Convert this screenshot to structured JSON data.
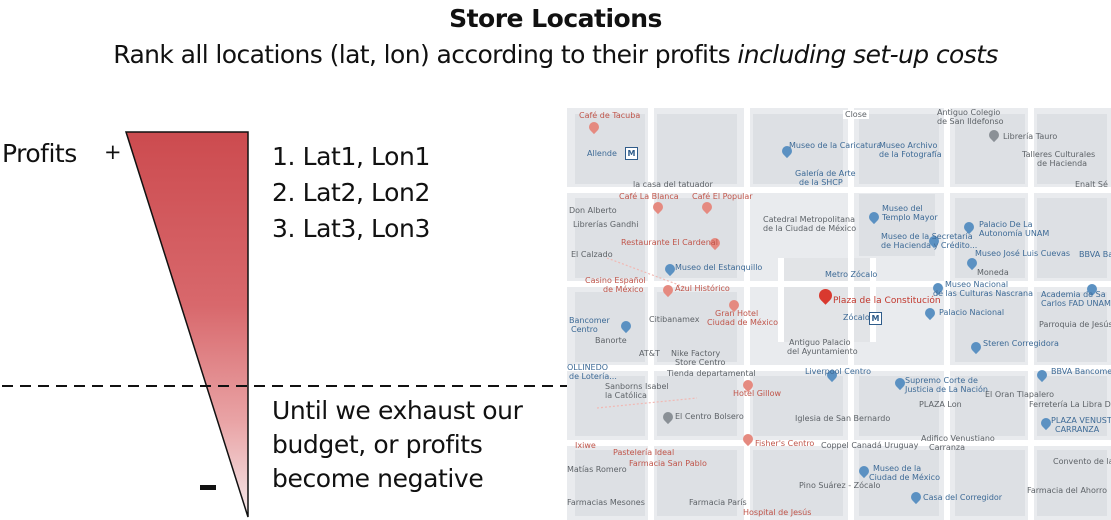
{
  "header": {
    "title": "Store Locations",
    "subtitle_main": "Rank all locations (lat, lon) according to their profits ",
    "subtitle_emphasis": "including set-up costs"
  },
  "funnel": {
    "axis_label": "Profits",
    "top_sign": "+",
    "bottom_sign": "–",
    "gradient_top_color": "#cc4b4f",
    "gradient_bottom_color": "#f5e9ea"
  },
  "ranking": {
    "items": [
      "1. Lat1, Lon1",
      "2. Lat2, Lon2",
      "3. Lat3, Lon3"
    ]
  },
  "cutoff": {
    "lines": [
      "Until we exhaust our",
      "budget, or profits",
      "become negative"
    ]
  },
  "map": {
    "highlight_place": "Plaza de la Constitución",
    "pois": [
      {
        "text": "Café de Tacuba",
        "tone": "red",
        "pin": false
      },
      {
        "text": "Antiguo Colegio",
        "tone": "gray",
        "pin": false
      },
      {
        "text": "de San Ildefonso",
        "tone": "gray",
        "pin": false
      },
      {
        "text": "Close",
        "tone": "gray",
        "pin": false
      },
      {
        "text": "Librería Tauro",
        "tone": "gray",
        "pin": false
      },
      {
        "text": "Museo de la Caricatura",
        "tone": "blue",
        "pin": false
      },
      {
        "text": "Museo Archivo",
        "tone": "blue",
        "pin": false
      },
      {
        "text": "de la Fotografía",
        "tone": "blue",
        "pin": false
      },
      {
        "text": "Allende",
        "tone": "blue",
        "pin": false
      },
      {
        "text": "Talleres Culturales",
        "tone": "gray",
        "pin": false
      },
      {
        "text": "de Hacienda",
        "tone": "gray",
        "pin": false
      },
      {
        "text": "Enalt Sé",
        "tone": "gray",
        "pin": false
      },
      {
        "text": "la casa del tatuador",
        "tone": "gray",
        "pin": false
      },
      {
        "text": "Galería de Arte",
        "tone": "blue",
        "pin": false
      },
      {
        "text": "de la SHCP",
        "tone": "blue",
        "pin": false
      },
      {
        "text": "Café La Blanca",
        "tone": "red",
        "pin": false
      },
      {
        "text": "Café El Popular",
        "tone": "red",
        "pin": false
      },
      {
        "text": "Palacio De La",
        "tone": "blue",
        "pin": false
      },
      {
        "text": "Autonomía UNAM",
        "tone": "blue",
        "pin": false
      },
      {
        "text": "Don Alberto",
        "tone": "gray",
        "pin": false
      },
      {
        "text": "Librerías Gandhi",
        "tone": "gray",
        "pin": false
      },
      {
        "text": "Museo del",
        "tone": "blue",
        "pin": false
      },
      {
        "text": "Templo Mayor",
        "tone": "blue",
        "pin": false
      },
      {
        "text": "Catedral Metropolitana",
        "tone": "gray",
        "pin": false
      },
      {
        "text": "de la Ciudad de México",
        "tone": "gray",
        "pin": false
      },
      {
        "text": "Museo de la Secretaría",
        "tone": "blue",
        "pin": false
      },
      {
        "text": "de Hacienda y Crédito...",
        "tone": "blue",
        "pin": false
      },
      {
        "text": "Museo José Luis Cuevas",
        "tone": "blue",
        "pin": false
      },
      {
        "text": "BBVA Ban",
        "tone": "blue",
        "pin": false
      },
      {
        "text": "Restaurante El Cardenal",
        "tone": "red",
        "pin": false
      },
      {
        "text": "El Calzado",
        "tone": "gray",
        "pin": false
      },
      {
        "text": "Museo del Estanquillo",
        "tone": "blue",
        "pin": false
      },
      {
        "text": "Metro Zócalo",
        "tone": "blue",
        "pin": false
      },
      {
        "text": "Moneda",
        "tone": "gray",
        "pin": false
      },
      {
        "text": "Casino Español",
        "tone": "red",
        "pin": false
      },
      {
        "text": "de México",
        "tone": "red",
        "pin": false
      },
      {
        "text": "Azul Histórico",
        "tone": "red",
        "pin": false
      },
      {
        "text": "Museo Nacional",
        "tone": "blue",
        "pin": false
      },
      {
        "text": "de las Culturas Nascrana",
        "tone": "blue",
        "pin": false
      },
      {
        "text": "Academia de Sa",
        "tone": "blue",
        "pin": false
      },
      {
        "text": "Carlos FAD UNAM",
        "tone": "blue",
        "pin": false
      },
      {
        "text": "Bancomer",
        "tone": "blue",
        "pin": false
      },
      {
        "text": "Centro",
        "tone": "blue",
        "pin": false
      },
      {
        "text": "Citibanamex",
        "tone": "gray",
        "pin": false
      },
      {
        "text": "Gran Hotel",
        "tone": "red",
        "pin": false
      },
      {
        "text": "Ciudad de México",
        "tone": "red",
        "pin": false
      },
      {
        "text": "Zócalo",
        "tone": "blue",
        "pin": false
      },
      {
        "text": "Palacio Nacional",
        "tone": "blue",
        "pin": false
      },
      {
        "text": "Parroquia de Jesús María",
        "tone": "gray",
        "pin": false
      },
      {
        "text": "Banorte",
        "tone": "gray",
        "pin": false
      },
      {
        "text": "AT&T",
        "tone": "gray",
        "pin": false
      },
      {
        "text": "Nike Factory",
        "tone": "gray",
        "pin": false
      },
      {
        "text": "Store Centro",
        "tone": "gray",
        "pin": false
      },
      {
        "text": "Antiguo Palacio",
        "tone": "gray",
        "pin": false
      },
      {
        "text": "del Ayuntamiento",
        "tone": "gray",
        "pin": false
      },
      {
        "text": "Steren Corregidora",
        "tone": "blue",
        "pin": false
      },
      {
        "text": "OLLINEDO",
        "tone": "blue",
        "pin": false
      },
      {
        "text": "de Lotería...",
        "tone": "blue",
        "pin": false
      },
      {
        "text": "Tienda departamental",
        "tone": "gray",
        "pin": false
      },
      {
        "text": "Liverpool Centro",
        "tone": "blue",
        "pin": false
      },
      {
        "text": "BBVA Bancomer",
        "tone": "blue",
        "pin": false
      },
      {
        "text": "Sanborns Isabel",
        "tone": "gray",
        "pin": false
      },
      {
        "text": "la Católica",
        "tone": "gray",
        "pin": false
      },
      {
        "text": "Hotel Gillow",
        "tone": "red",
        "pin": false
      },
      {
        "text": "Supremo Corte de",
        "tone": "blue",
        "pin": false
      },
      {
        "text": "Justicia de La Nación",
        "tone": "blue",
        "pin": false
      },
      {
        "text": "PLAZA Lon",
        "tone": "gray",
        "pin": false
      },
      {
        "text": "El Oran Tlapalero",
        "tone": "gray",
        "pin": false
      },
      {
        "text": "Ferretería La Libra De",
        "tone": "gray",
        "pin": false
      },
      {
        "text": "El Centro Bolsero",
        "tone": "gray",
        "pin": false
      },
      {
        "text": "Iglesia de San Bernardo",
        "tone": "gray",
        "pin": false
      },
      {
        "text": "PLAZA VENUSTIANO",
        "tone": "blue",
        "pin": false
      },
      {
        "text": "CARRANZA",
        "tone": "blue",
        "pin": false
      },
      {
        "text": "Fisher's Centro",
        "tone": "red",
        "pin": false
      },
      {
        "text": "Coppel Canadá Uruguay",
        "tone": "gray",
        "pin": false
      },
      {
        "text": "Adifico Venustiano",
        "tone": "gray",
        "pin": false
      },
      {
        "text": "Carranza",
        "tone": "gray",
        "pin": false
      },
      {
        "text": "Pastelería Ideal",
        "tone": "red",
        "pin": false
      },
      {
        "text": "Farmacia San Pablo",
        "tone": "red",
        "pin": false
      },
      {
        "text": "Matías Romero",
        "tone": "gray",
        "pin": false
      },
      {
        "text": "Museo de la",
        "tone": "blue",
        "pin": false
      },
      {
        "text": "Ciudad de México",
        "tone": "blue",
        "pin": false
      },
      {
        "text": "Convento de la M",
        "tone": "gray",
        "pin": false
      },
      {
        "text": "Pino Suárez - Zócalo",
        "tone": "gray",
        "pin": false
      },
      {
        "text": "Farmacia del Ahorro",
        "tone": "gray",
        "pin": false
      },
      {
        "text": "Farmacias Mesones",
        "tone": "gray",
        "pin": false
      },
      {
        "text": "Farmacia París",
        "tone": "gray",
        "pin": false
      },
      {
        "text": "Hospital de Jesús",
        "tone": "red",
        "pin": false
      },
      {
        "text": "Casa del Corregidor",
        "tone": "blue",
        "pin": false
      },
      {
        "text": "Ixiwe",
        "tone": "red",
        "pin": false
      }
    ]
  }
}
